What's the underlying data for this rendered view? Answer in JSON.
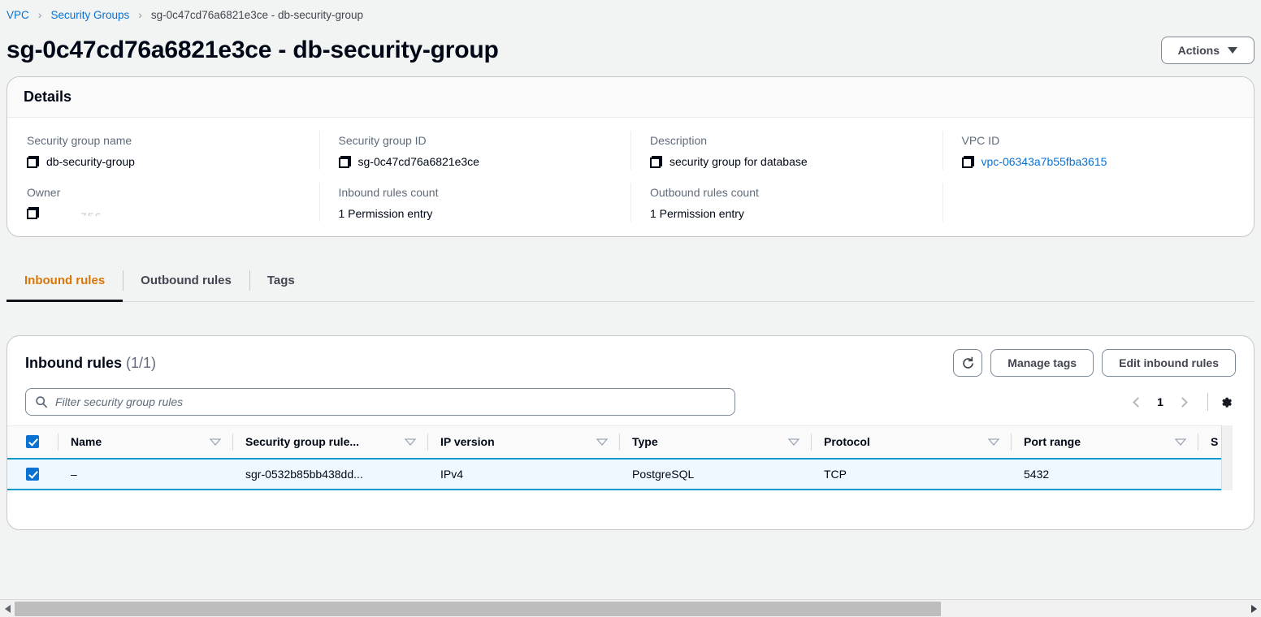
{
  "breadcrumb": {
    "items": [
      {
        "label": "VPC",
        "link": true
      },
      {
        "label": "Security Groups",
        "link": true
      },
      {
        "label": "sg-0c47cd76a6821e3ce - db-security-group",
        "link": false
      }
    ],
    "separator": "›"
  },
  "header": {
    "title": "sg-0c47cd76a6821e3ce - db-security-group",
    "actions_label": "Actions"
  },
  "details": {
    "section_title": "Details",
    "fields": [
      {
        "label": "Security group name",
        "value": "db-security-group",
        "copyable": true,
        "link": false
      },
      {
        "label": "Security group ID",
        "value": "sg-0c47cd76a6821e3ce",
        "copyable": true,
        "link": false
      },
      {
        "label": "Description",
        "value": "security group for database",
        "copyable": true,
        "link": false
      },
      {
        "label": "VPC ID",
        "value": "vpc-06343a7b55fba3615",
        "copyable": true,
        "link": true
      },
      {
        "label": "Owner",
        "value": "",
        "copyable": true,
        "link": false,
        "obscured": true
      },
      {
        "label": "Inbound rules count",
        "value": "1 Permission entry",
        "copyable": false,
        "link": false
      },
      {
        "label": "Outbound rules count",
        "value": "1 Permission entry",
        "copyable": false,
        "link": false
      }
    ]
  },
  "tabs": [
    {
      "label": "Inbound rules",
      "active": true
    },
    {
      "label": "Outbound rules",
      "active": false
    },
    {
      "label": "Tags",
      "active": false
    }
  ],
  "rules_panel": {
    "title": "Inbound rules",
    "count": "(1/1)",
    "refresh_icon": "refresh-icon",
    "manage_tags_label": "Manage tags",
    "edit_rules_label": "Edit inbound rules",
    "search_placeholder": "Filter security group rules",
    "search_value": "",
    "search_icon": "search-icon",
    "pagination": {
      "prev_icon": "chevron-left-icon",
      "page": "1",
      "next_icon": "chevron-right-icon",
      "settings_icon": "gear-icon"
    },
    "columns": [
      {
        "label": "Name",
        "sortable": true
      },
      {
        "label": "Security group rule...",
        "sortable": true
      },
      {
        "label": "IP version",
        "sortable": true
      },
      {
        "label": "Type",
        "sortable": true
      },
      {
        "label": "Protocol",
        "sortable": true
      },
      {
        "label": "Port range",
        "sortable": true
      },
      {
        "label": "S",
        "sortable": false
      }
    ],
    "rows": [
      {
        "selected": true,
        "cells": [
          "–",
          "sgr-0532b85bb438dd...",
          "IPv4",
          "PostgreSQL",
          "TCP",
          "5432",
          ""
        ]
      }
    ],
    "select_all_checked": true
  },
  "colors": {
    "accent_link": "#0972d3",
    "tab_active": "#d97706",
    "row_selected_border": "#0099cc",
    "row_selected_bg": "#f0f8ff"
  }
}
